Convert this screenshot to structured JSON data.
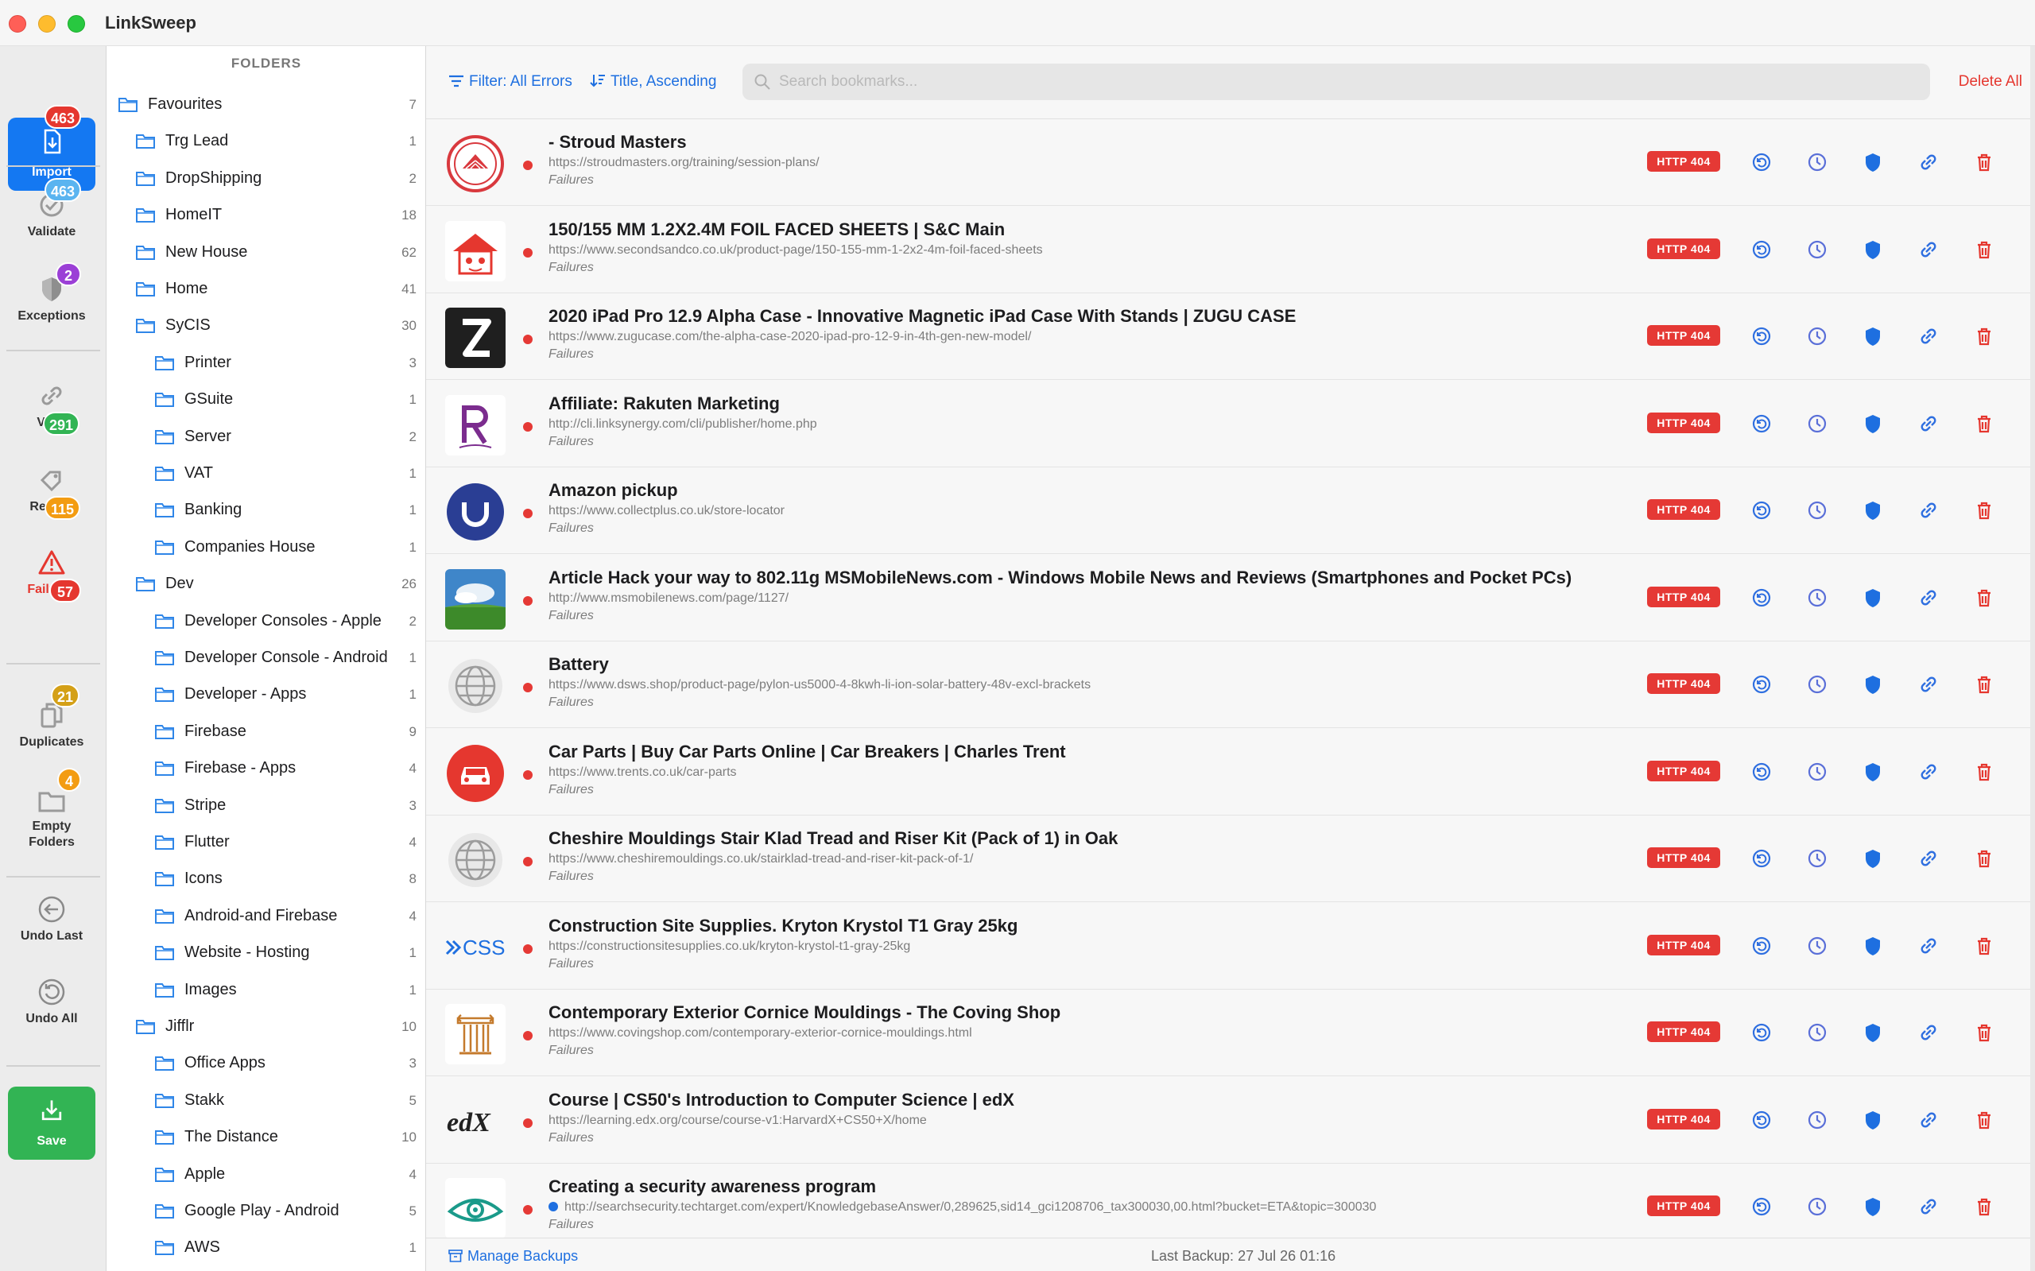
{
  "app": {
    "title": "LinkSweep"
  },
  "rail": {
    "import": {
      "label": "Import",
      "badge": "463"
    },
    "validate": {
      "label": "Validate",
      "badge": "463"
    },
    "exceptions": {
      "label": "Exceptions",
      "badge": "2"
    },
    "valid": {
      "label": "Valid",
      "badge": "291"
    },
    "review": {
      "label": "Review",
      "badge": "115"
    },
    "failures": {
      "label": "Failures",
      "badge": "57"
    },
    "duplicates": {
      "label": "Duplicates",
      "badge": "21"
    },
    "empty_folders": {
      "label_line1": "Empty",
      "label_line2": "Folders",
      "badge": "4"
    },
    "undo_last": {
      "label": "Undo Last"
    },
    "undo_all": {
      "label": "Undo All"
    },
    "save": {
      "label": "Save"
    },
    "colors": {
      "blue": "#1478f2",
      "green": "#32b454",
      "red": "#e5372f",
      "orange": "#f39c12",
      "purple": "#9b3fd6",
      "light_blue": "#5ab4f0",
      "amber": "#d4a017"
    }
  },
  "folders": {
    "header": "FOLDERS",
    "items": [
      {
        "name": "Favourites",
        "count": "7",
        "level": 0
      },
      {
        "name": "Trg Lead",
        "count": "1",
        "level": 1
      },
      {
        "name": "DropShipping",
        "count": "2",
        "level": 1
      },
      {
        "name": "HomeIT",
        "count": "18",
        "level": 1
      },
      {
        "name": "New House",
        "count": "62",
        "level": 1
      },
      {
        "name": "Home",
        "count": "41",
        "level": 1
      },
      {
        "name": "SyCIS",
        "count": "30",
        "level": 1
      },
      {
        "name": "Printer",
        "count": "3",
        "level": 2
      },
      {
        "name": "GSuite",
        "count": "1",
        "level": 2
      },
      {
        "name": "Server",
        "count": "2",
        "level": 2
      },
      {
        "name": "VAT",
        "count": "1",
        "level": 2
      },
      {
        "name": "Banking",
        "count": "1",
        "level": 2
      },
      {
        "name": "Companies House",
        "count": "1",
        "level": 2
      },
      {
        "name": "Dev",
        "count": "26",
        "level": 1
      },
      {
        "name": "Developer Consoles - Apple",
        "count": "2",
        "level": 2
      },
      {
        "name": "Developer Console - Android",
        "count": "1",
        "level": 2
      },
      {
        "name": "Developer - Apps",
        "count": "1",
        "level": 2
      },
      {
        "name": "Firebase",
        "count": "9",
        "level": 2
      },
      {
        "name": "Firebase - Apps",
        "count": "4",
        "level": 2
      },
      {
        "name": "Stripe",
        "count": "3",
        "level": 2
      },
      {
        "name": "Flutter",
        "count": "4",
        "level": 2
      },
      {
        "name": "Icons",
        "count": "8",
        "level": 2
      },
      {
        "name": "Android-and Firebase",
        "count": "4",
        "level": 2
      },
      {
        "name": "Website - Hosting",
        "count": "1",
        "level": 2
      },
      {
        "name": "Images",
        "count": "1",
        "level": 2
      },
      {
        "name": "Jifflr",
        "count": "10",
        "level": 1
      },
      {
        "name": "Office Apps",
        "count": "3",
        "level": 2
      },
      {
        "name": "Stakk",
        "count": "5",
        "level": 2
      },
      {
        "name": "The Distance",
        "count": "10",
        "level": 2
      },
      {
        "name": "Apple",
        "count": "4",
        "level": 2
      },
      {
        "name": "Google Play - Android",
        "count": "5",
        "level": 2
      },
      {
        "name": "AWS",
        "count": "1",
        "level": 2
      }
    ]
  },
  "toolbar": {
    "filter_label": "Filter: All Errors",
    "sort_label": "Title, Ascending",
    "search_placeholder": "Search bookmarks...",
    "search_value": "",
    "delete_all_label": "Delete All"
  },
  "bookmarks": [
    {
      "title": "- Stroud Masters",
      "url": "https://stroudmasters.org/training/session-plans/",
      "status": "Failures",
      "http": "HTTP 404",
      "thumb": "stroud"
    },
    {
      "title": "150/155 MM 1.2X2.4M FOIL FACED SHEETS | S&C Main",
      "url": "https://www.secondsandco.co.uk/product-page/150-155-mm-1-2x2-4m-foil-faced-sheets",
      "status": "Failures",
      "http": "HTTP 404",
      "thumb": "house"
    },
    {
      "title": "2020 iPad Pro 12.9 Alpha Case - Innovative Magnetic iPad Case With Stands | ZUGU CASE",
      "url": "https://www.zugucase.com/the-alpha-case-2020-ipad-pro-12-9-in-4th-gen-new-model/",
      "status": "Failures",
      "http": "HTTP 404",
      "thumb": "zugu"
    },
    {
      "title": "Affiliate: Rakuten Marketing",
      "url": "http://cli.linksynergy.com/cli/publisher/home.php",
      "status": "Failures",
      "http": "HTTP 404",
      "thumb": "rakuten"
    },
    {
      "title": "Amazon pickup",
      "url": "https://www.collectplus.co.uk/store-locator",
      "status": "Failures",
      "http": "HTTP 404",
      "thumb": "collectplus"
    },
    {
      "title": "Article Hack your way to 802.11g MSMobileNews.com - Windows Mobile News and Reviews (Smartphones and Pocket PCs)",
      "url": "http://www.msmobilenews.com/page/1127/",
      "status": "Failures",
      "http": "HTTP 404",
      "thumb": "landscape"
    },
    {
      "title": "Battery",
      "url": "https://www.dsws.shop/product-page/pylon-us5000-4-8kwh-li-ion-solar-battery-48v-excl-brackets",
      "status": "Failures",
      "http": "HTTP 404",
      "thumb": "globe"
    },
    {
      "title": "Car Parts | Buy Car Parts Online | Car Breakers | Charles Trent",
      "url": "https://www.trents.co.uk/car-parts",
      "status": "Failures",
      "http": "HTTP 404",
      "thumb": "car"
    },
    {
      "title": "Cheshire Mouldings Stair Klad Tread and Riser Kit (Pack of 1) in Oak",
      "url": "https://www.cheshiremouldings.co.uk/stairklad-tread-and-riser-kit-pack-of-1/",
      "status": "Failures",
      "http": "HTTP 404",
      "thumb": "globe"
    },
    {
      "title": "Construction Site Supplies. Kryton Krystol T1 Gray 25kg",
      "url": "https://constructionsitesupplies.co.uk/kryton-krystol-t1-gray-25kg",
      "status": "Failures",
      "http": "HTTP 404",
      "thumb": "css"
    },
    {
      "title": "Contemporary Exterior Cornice Mouldings - The Coving Shop",
      "url": "https://www.covingshop.com/contemporary-exterior-cornice-mouldings.html",
      "status": "Failures",
      "http": "HTTP 404",
      "thumb": "column"
    },
    {
      "title": "Course | CS50's Introduction to Computer Science | edX",
      "url": "https://learning.edx.org/course/course-v1:HarvardX+CS50+X/home",
      "status": "Failures",
      "http": "HTTP 404",
      "thumb": "edx"
    },
    {
      "title": "Creating a security awareness program",
      "url": "http://searchsecurity.techtarget.com/expert/KnowledgebaseAnswer/0,289625,sid14_gci1208706_tax300030,00.html?bucket=ETA&topic=300030",
      "status": "Failures",
      "http": "HTTP 404",
      "thumb": "eye"
    }
  ],
  "footer": {
    "manage_backups_label": "Manage Backups",
    "last_backup_label": "Last Backup: 27 Jul 26 01:16"
  }
}
